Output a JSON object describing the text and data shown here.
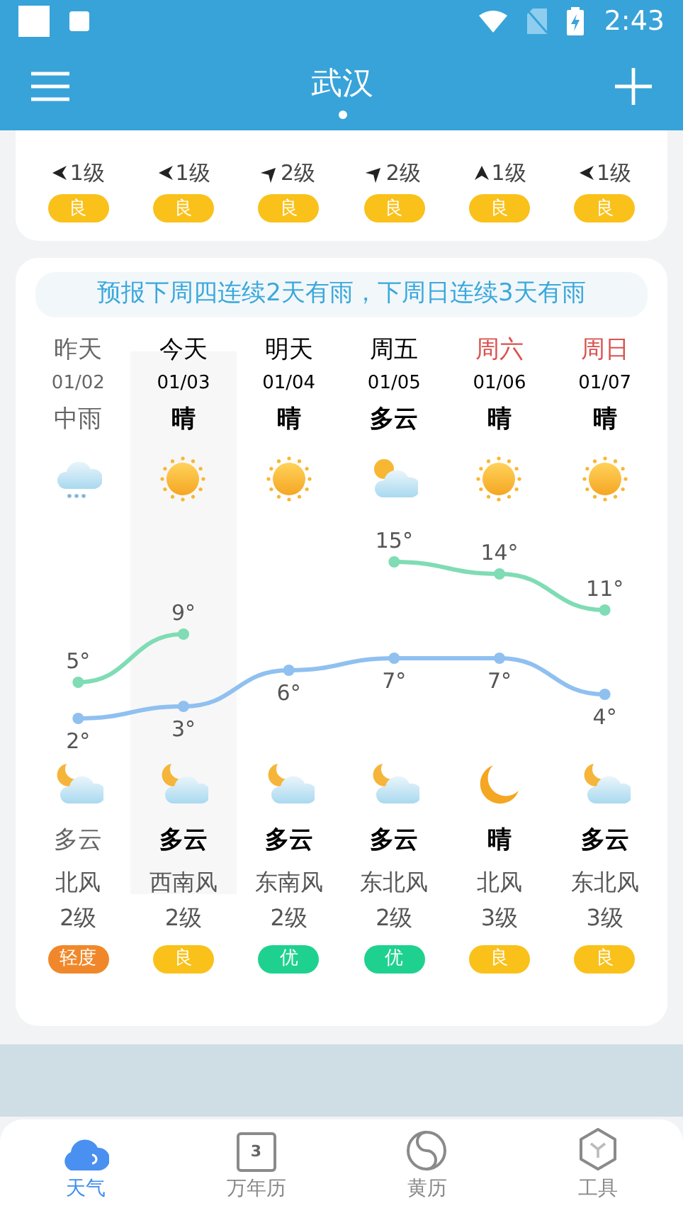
{
  "status_bar": {
    "time": "2:43"
  },
  "header": {
    "title": "武汉"
  },
  "top_card": {
    "columns": [
      {
        "kind": "left",
        "wind_level": "1级",
        "aqi": "良",
        "color": "#f9c11a"
      },
      {
        "kind": "left",
        "wind_level": "1级",
        "aqi": "良",
        "color": "#f9c11a"
      },
      {
        "kind": "up-right",
        "wind_level": "2级",
        "aqi": "良",
        "color": "#f9c11a"
      },
      {
        "kind": "up-right",
        "wind_level": "2级",
        "aqi": "良",
        "color": "#f9c11a"
      },
      {
        "kind": "up",
        "wind_level": "1级",
        "aqi": "良",
        "color": "#f9c11a"
      },
      {
        "kind": "left",
        "wind_level": "1级",
        "aqi": "良",
        "color": "#f9c11a"
      }
    ]
  },
  "forecast": {
    "banner": "预报下周四连续2天有雨，下周日连续3天有雨",
    "days": [
      {
        "day": "昨天",
        "date": "01/02",
        "weather": "中雨",
        "kind": "rain",
        "night": {
          "weather": "多云",
          "kind": "moon-cloud"
        },
        "wind": "北风",
        "wind_level": "2级",
        "aqi": "轻度",
        "color": "#f0882b",
        "past": true,
        "weekend": false,
        "selected": false
      },
      {
        "day": "今天",
        "date": "01/03",
        "weather": "晴",
        "kind": "sun",
        "night": {
          "weather": "多云",
          "kind": "moon-cloud"
        },
        "wind": "西南风",
        "wind_level": "2级",
        "aqi": "良",
        "color": "#f9c11a",
        "past": false,
        "weekend": false,
        "selected": true
      },
      {
        "day": "明天",
        "date": "01/04",
        "weather": "晴",
        "kind": "sun",
        "night": {
          "weather": "多云",
          "kind": "moon-cloud"
        },
        "wind": "东南风",
        "wind_level": "2级",
        "aqi": "优",
        "color": "#1fd18f",
        "past": false,
        "weekend": false,
        "selected": false
      },
      {
        "day": "周五",
        "date": "01/05",
        "weather": "多云",
        "kind": "sun-cloud",
        "night": {
          "weather": "多云",
          "kind": "moon-cloud"
        },
        "wind": "东北风",
        "wind_level": "2级",
        "aqi": "优",
        "color": "#1fd18f",
        "past": false,
        "weekend": false,
        "selected": false
      },
      {
        "day": "周六",
        "date": "01/06",
        "weather": "晴",
        "kind": "sun",
        "night": {
          "weather": "晴",
          "kind": "moon"
        },
        "wind": "北风",
        "wind_level": "3级",
        "aqi": "良",
        "color": "#f9c11a",
        "past": false,
        "weekend": true,
        "selected": false
      },
      {
        "day": "周日",
        "date": "01/07",
        "weather": "晴",
        "kind": "sun",
        "night": {
          "weather": "多云",
          "kind": "moon-cloud"
        },
        "wind": "东北风",
        "wind_level": "3级",
        "aqi": "良",
        "color": "#f9c11a",
        "past": false,
        "weekend": true,
        "selected": false
      }
    ],
    "chart_data": {
      "type": "line",
      "data_labels": true,
      "series": [
        {
          "color": "#7fdcb4",
          "marker": "circle",
          "values": [
            5,
            9,
            null,
            15,
            14,
            11
          ],
          "value_labels": [
            "5°",
            "9°",
            null,
            "15°",
            "14°",
            "11°"
          ]
        },
        {
          "color": "#8fc0f0",
          "marker": "circle",
          "values": [
            2,
            3,
            6,
            7,
            7,
            4
          ],
          "value_labels": [
            "2°",
            "3°",
            "6°",
            "7°",
            "7°",
            "4°"
          ]
        }
      ]
    }
  },
  "nav": [
    {
      "label": "天气",
      "kind": "cloud",
      "selected": true
    },
    {
      "label": "万年历",
      "kind": "calendar",
      "icon_text": "3",
      "selected": false
    },
    {
      "label": "黄历",
      "kind": "yinyang",
      "selected": false
    },
    {
      "label": "工具",
      "kind": "hexagon",
      "selected": false
    }
  ]
}
